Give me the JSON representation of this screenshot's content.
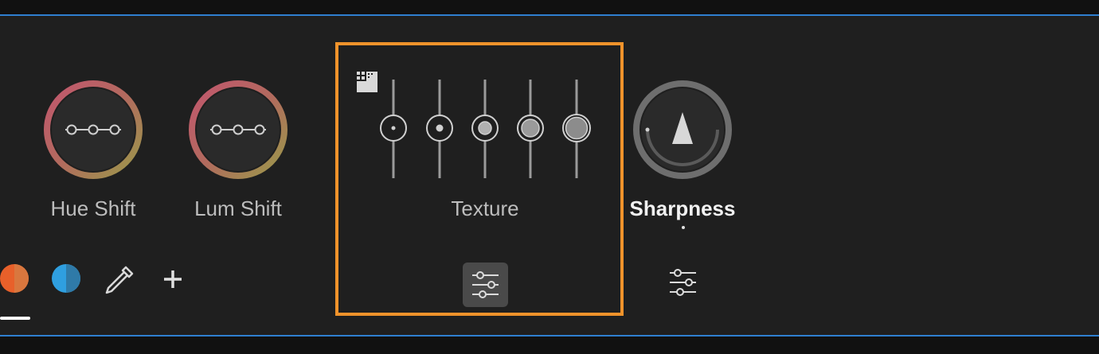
{
  "controls": {
    "hue_shift": {
      "label": "Hue Shift"
    },
    "lum_shift": {
      "label": "Lum Shift"
    },
    "texture": {
      "label": "Texture",
      "selected": true,
      "selected_step": 4,
      "step_count": 5
    },
    "sharpness": {
      "label": "Sharpness",
      "active": true
    }
  },
  "toolbar": {
    "items": [
      {
        "icon": "orange-color-swatch-icon",
        "selected": true
      },
      {
        "icon": "blue-color-swatch-icon"
      },
      {
        "icon": "eyedropper-icon"
      },
      {
        "icon": "plus-icon",
        "label": "+"
      }
    ]
  },
  "colors": {
    "panel_bg": "#1f1f1f",
    "highlight_border": "#f0932b",
    "accent_line": "#2f7fd0",
    "swatch_orange": "#e8602a",
    "swatch_blue": "#2f9fe0"
  }
}
